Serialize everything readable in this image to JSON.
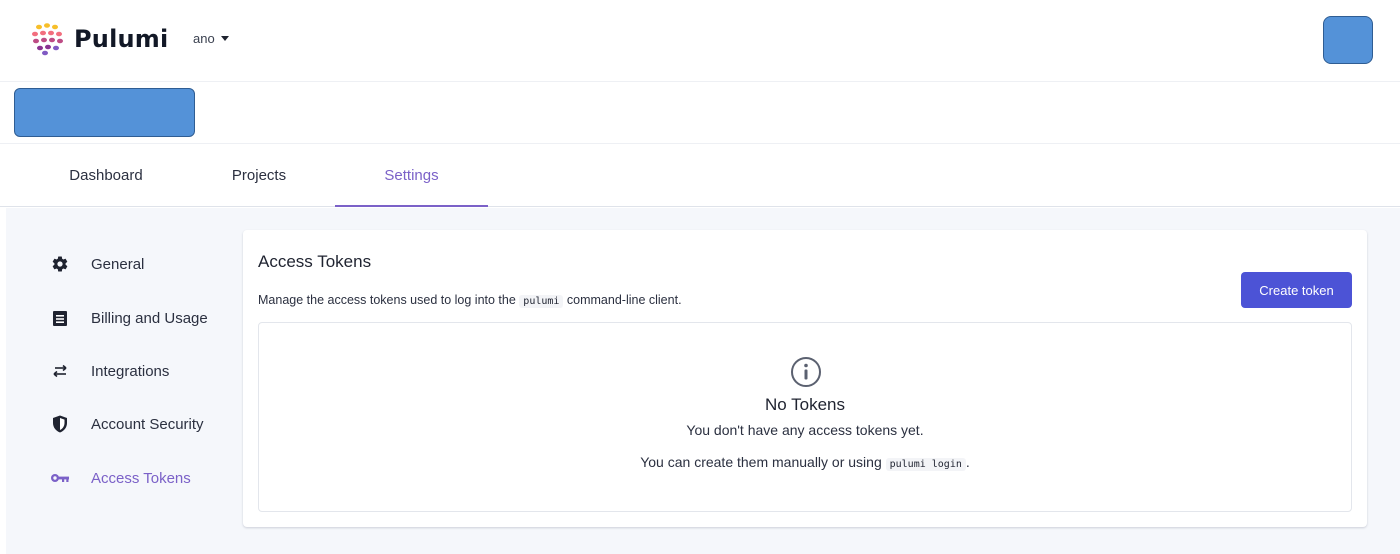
{
  "brand": {
    "name": "Pulumi",
    "logo_icon": "pulumi-logo-icon",
    "colors": [
      "#f7bf2a",
      "#f26e7e",
      "#bd4c85",
      "#8a3391",
      "#805ac3"
    ]
  },
  "header": {
    "org_name": "ano",
    "avatar_color": "#5492d8"
  },
  "tabs": [
    {
      "label": "Dashboard"
    },
    {
      "label": "Projects"
    },
    {
      "label": "Settings",
      "active": true
    }
  ],
  "sidebar": {
    "items": [
      {
        "label": "General",
        "icon": "gear-icon"
      },
      {
        "label": "Billing and Usage",
        "icon": "receipt-icon"
      },
      {
        "label": "Integrations",
        "icon": "arrows-exchange-icon"
      },
      {
        "label": "Account Security",
        "icon": "shield-icon"
      },
      {
        "label": "Access Tokens",
        "icon": "key-icon",
        "active": true
      }
    ]
  },
  "panel": {
    "title": "Access Tokens",
    "desc_before": "Manage the access tokens used to log into the",
    "desc_code": "pulumi",
    "desc_after": "command-line client.",
    "create_button": "Create token",
    "empty": {
      "icon": "info-icon",
      "title": "No Tokens",
      "line1": "You don't have any access tokens yet.",
      "line2_before": "You can create them manually or using",
      "line2_code": "pulumi login",
      "line2_after": "."
    }
  },
  "accent_color": "#7b61c8",
  "button_color": "#4c53d6"
}
